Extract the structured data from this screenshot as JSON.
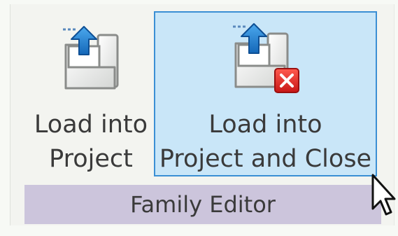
{
  "ribbon_panel": {
    "buttons": [
      {
        "label": "Load into\nProject",
        "icon": "load-into-project-icon",
        "active": false
      },
      {
        "label": "Load into\nProject and Close",
        "icon": "load-into-project-and-close-icon",
        "active": true
      }
    ],
    "title": "Family Editor"
  },
  "colors": {
    "hover_fill": "#c9e6f8",
    "hover_border": "#3b8fd4",
    "panel_title_bar": "#ccc5dc",
    "arrow_blue": "#1a7bd0",
    "close_red": "#e02a2a"
  },
  "cursor": {
    "icon": "mouse-pointer-icon"
  }
}
